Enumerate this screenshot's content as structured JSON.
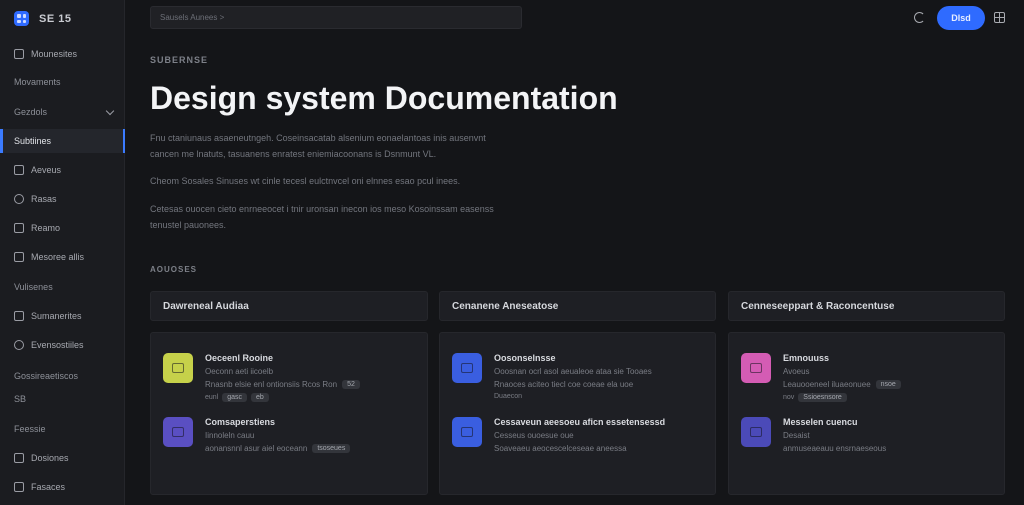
{
  "brand": {
    "name": "SE 15"
  },
  "sidebar": {
    "items": [
      {
        "label": "Mounesites",
        "icon": "box-icon",
        "type": "item"
      },
      {
        "label": "Movaments",
        "icon": "",
        "type": "section"
      },
      {
        "label": "Gezdols",
        "icon": "",
        "type": "section-collapsible"
      },
      {
        "label": "Subtiines",
        "icon": "",
        "type": "active"
      },
      {
        "label": "Aeveus",
        "icon": "file-icon",
        "type": "item"
      },
      {
        "label": "Rasas",
        "icon": "circle-icon",
        "type": "item"
      },
      {
        "label": "Reamo",
        "icon": "split-icon",
        "type": "item"
      },
      {
        "label": "Mesoree allis",
        "icon": "square-icon",
        "type": "item"
      },
      {
        "label": "Vulisenes",
        "icon": "",
        "type": "section"
      },
      {
        "label": "Sumanerites",
        "icon": "layers-icon",
        "type": "item"
      },
      {
        "label": "Evensostiiles",
        "icon": "clock-icon",
        "type": "item"
      },
      {
        "label": "Gossireaetiscos",
        "icon": "",
        "type": "section"
      },
      {
        "label": "SB",
        "icon": "",
        "type": "section"
      },
      {
        "label": "Feessie",
        "icon": "",
        "type": "section"
      },
      {
        "label": "Dosiones",
        "icon": "grid-icon",
        "type": "item"
      },
      {
        "label": "Fasaces",
        "icon": "book-icon",
        "type": "item"
      }
    ]
  },
  "topbar": {
    "search_placeholder": "Sausels Aunees >",
    "primary_label": "Dlsd"
  },
  "main": {
    "eyebrow": "SUBERNSE",
    "title": "Design system Documentation",
    "paragraphs": [
      "Fnu ctaniunaus asaeneutngeh. Coseinsacatab alsenium eonaelantoas inis ausenvnt cancen me lnatuts, tasuanens enratest eniemiacoonans is Dsnmunt VL.",
      "Cheom Sosales Sinuses wt cinle tecesl eulctnvcel oni elnnes esao pcul inees.",
      "Cetesas ouocen cieto enrneeocet i tnir uronsan inecon ios meso Kosoinssam easenss tenustel pauonees."
    ],
    "section_label": "AOUOSES"
  },
  "columns": [
    {
      "header": "Dawreneal Audiaa",
      "entries": [
        {
          "title": "Oeceenl Rooine",
          "sub": "Oeconn aeti iicoelb",
          "line": "Rnasnb elsie enl ontionsiis Rcos Ron",
          "chip": "52",
          "tags": [
            "eunl",
            "gasc",
            "eb"
          ],
          "icon_color": "#c6d14a"
        },
        {
          "title": "Comsaperstiens",
          "sub": "Iinnoleln cauu",
          "line": "aonansnnl asur aiel eoceann",
          "chip": "tsoseues",
          "tags": [],
          "icon_color": "#5a4fc2"
        }
      ]
    },
    {
      "header": "Cenanene Aneseatose",
      "entries": [
        {
          "title": "Oosonselnsse",
          "sub": "",
          "line": "Ooosnan ocrl asol aeualeoe ataa sie Tooaes",
          "chip": "",
          "tags": [
            "Rnaoces aciteo tiecl coe coeae ela uoe"
          ],
          "sub2": "Duaecon",
          "icon_color": "#3a5ee0"
        },
        {
          "title": "Cessaveun aeesoeu aficn essetensessd",
          "sub": "Cesseus ouoesue oue",
          "line": "Soaveaeu aeocescelceseae aneessa",
          "chip": "",
          "tags": [],
          "icon_color": "#3a5ee0"
        }
      ]
    },
    {
      "header": "Cenneseeppart & Raconcentuse",
      "entries": [
        {
          "title": "Emnouuss",
          "sub": "Avoeus",
          "line": "Leauooeneel iluaeonuee",
          "chip": "nsoe",
          "tags": [
            "nov",
            "Ssioesnsore"
          ],
          "icon_color": "#d45cb4"
        },
        {
          "title": "Messelen cuencu",
          "sub": "Desaist",
          "line": "anmuseaeauu ensrnaeseous",
          "chip": "",
          "tags": [],
          "icon_color": "#4b4ab8"
        }
      ]
    }
  ]
}
